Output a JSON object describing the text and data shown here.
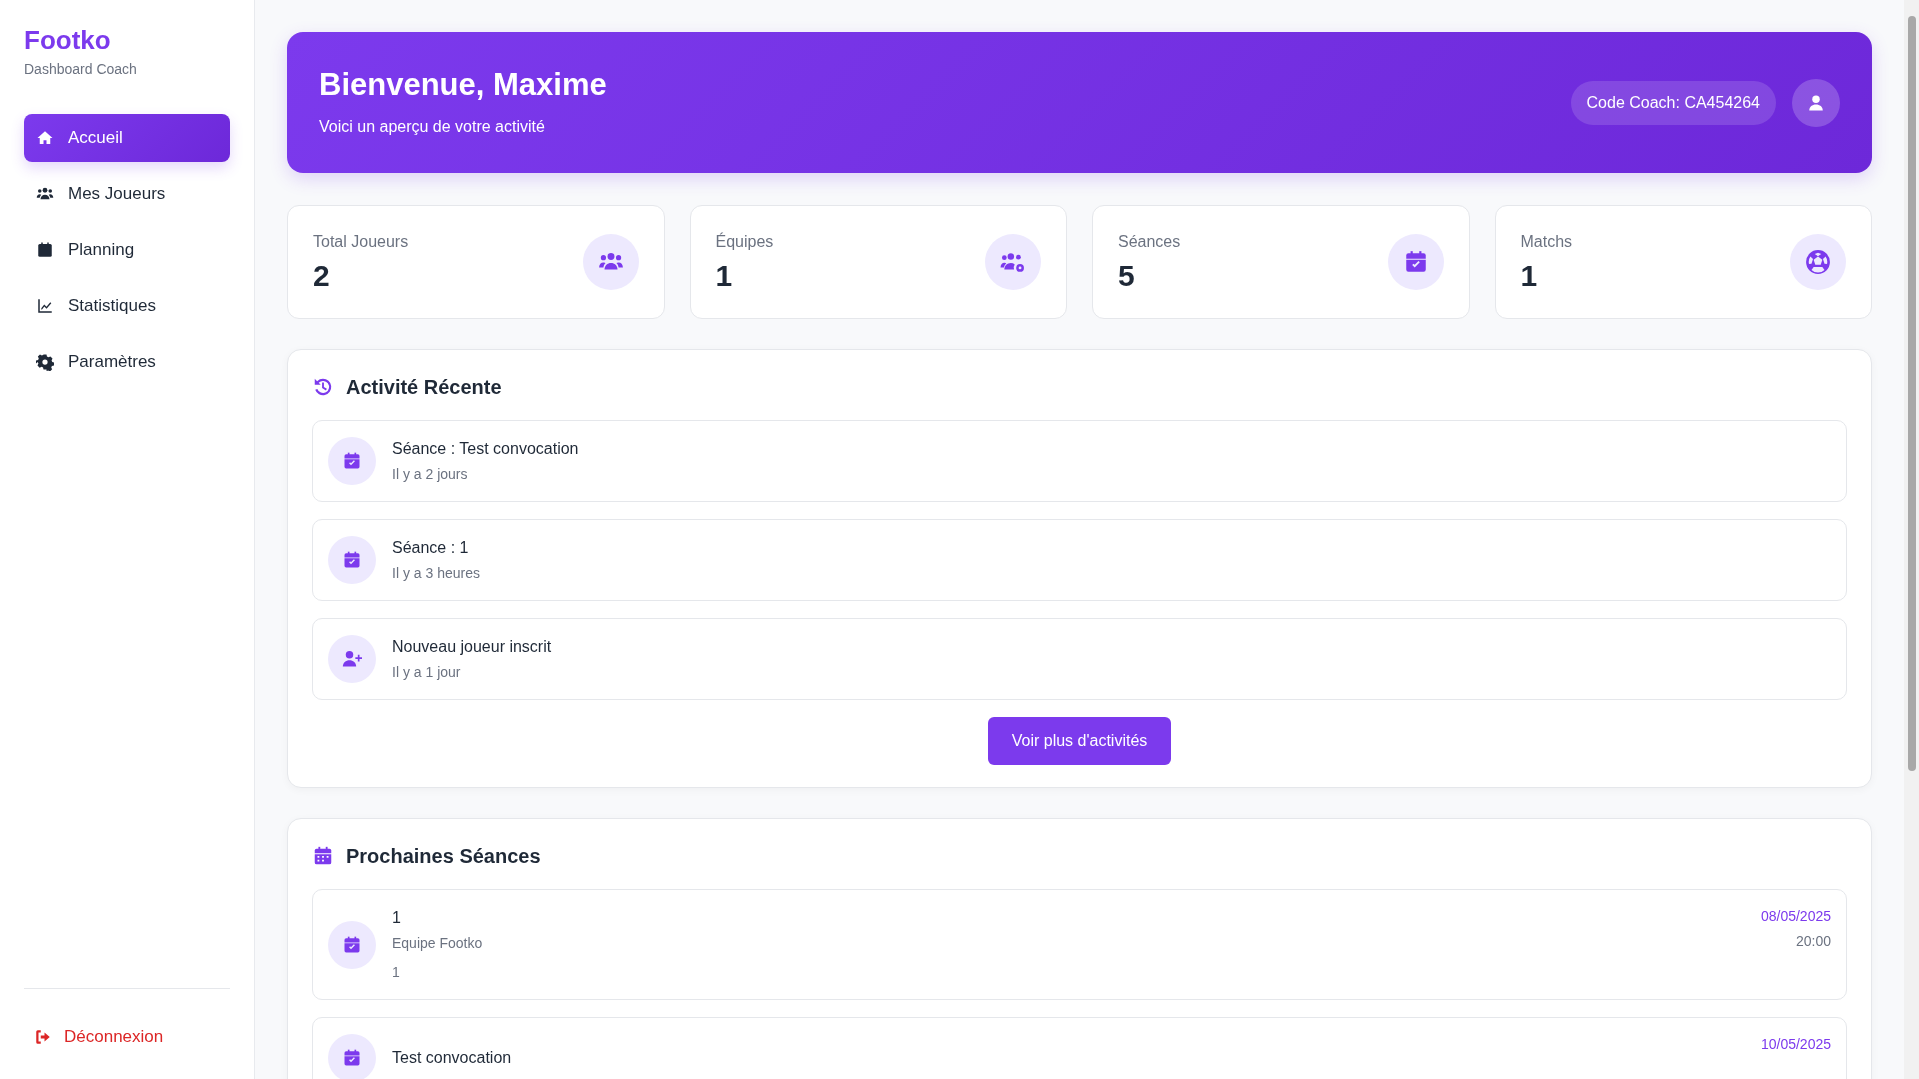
{
  "brand": {
    "name": "Footko",
    "subtitle": "Dashboard Coach"
  },
  "sidebar": {
    "items": [
      {
        "label": "Accueil",
        "kind": "home",
        "selected": true
      },
      {
        "label": "Mes Joueurs",
        "kind": "users",
        "selected": false
      },
      {
        "label": "Planning",
        "kind": "calendar",
        "selected": false
      },
      {
        "label": "Statistiques",
        "kind": "chart",
        "selected": false
      },
      {
        "label": "Paramètres",
        "kind": "gear",
        "selected": false
      }
    ],
    "logout": "Déconnexion"
  },
  "header": {
    "title": "Bienvenue, Maxime",
    "subtitle": "Voici un aperçu de votre activité",
    "coach_code": "Code Coach: CA454264"
  },
  "stats": [
    {
      "label": "Total Joueurs",
      "value": "2",
      "kind": "users"
    },
    {
      "label": "Équipes",
      "value": "1",
      "kind": "users-gear"
    },
    {
      "label": "Séances",
      "value": "5",
      "kind": "calendar-check"
    },
    {
      "label": "Matchs",
      "value": "1",
      "kind": "ball"
    }
  ],
  "recent_activity": {
    "title": "Activité Récente",
    "items": [
      {
        "title": "Séance : Test convocation",
        "time": "Il y a 2 jours",
        "kind": "calendar-check"
      },
      {
        "title": "Séance : 1",
        "time": "Il y a 3 heures",
        "kind": "calendar-check"
      },
      {
        "title": "Nouveau joueur inscrit",
        "time": "Il y a 1 jour",
        "kind": "user-plus"
      }
    ],
    "button": "Voir plus d'activités"
  },
  "upcoming_sessions": {
    "title": "Prochaines Séances",
    "items": [
      {
        "name": "1",
        "team": "Equipe Footko",
        "note": "1",
        "date": "08/05/2025",
        "time": "20:00"
      },
      {
        "name": "Test convocation",
        "date": "10/05/2025"
      }
    ]
  }
}
